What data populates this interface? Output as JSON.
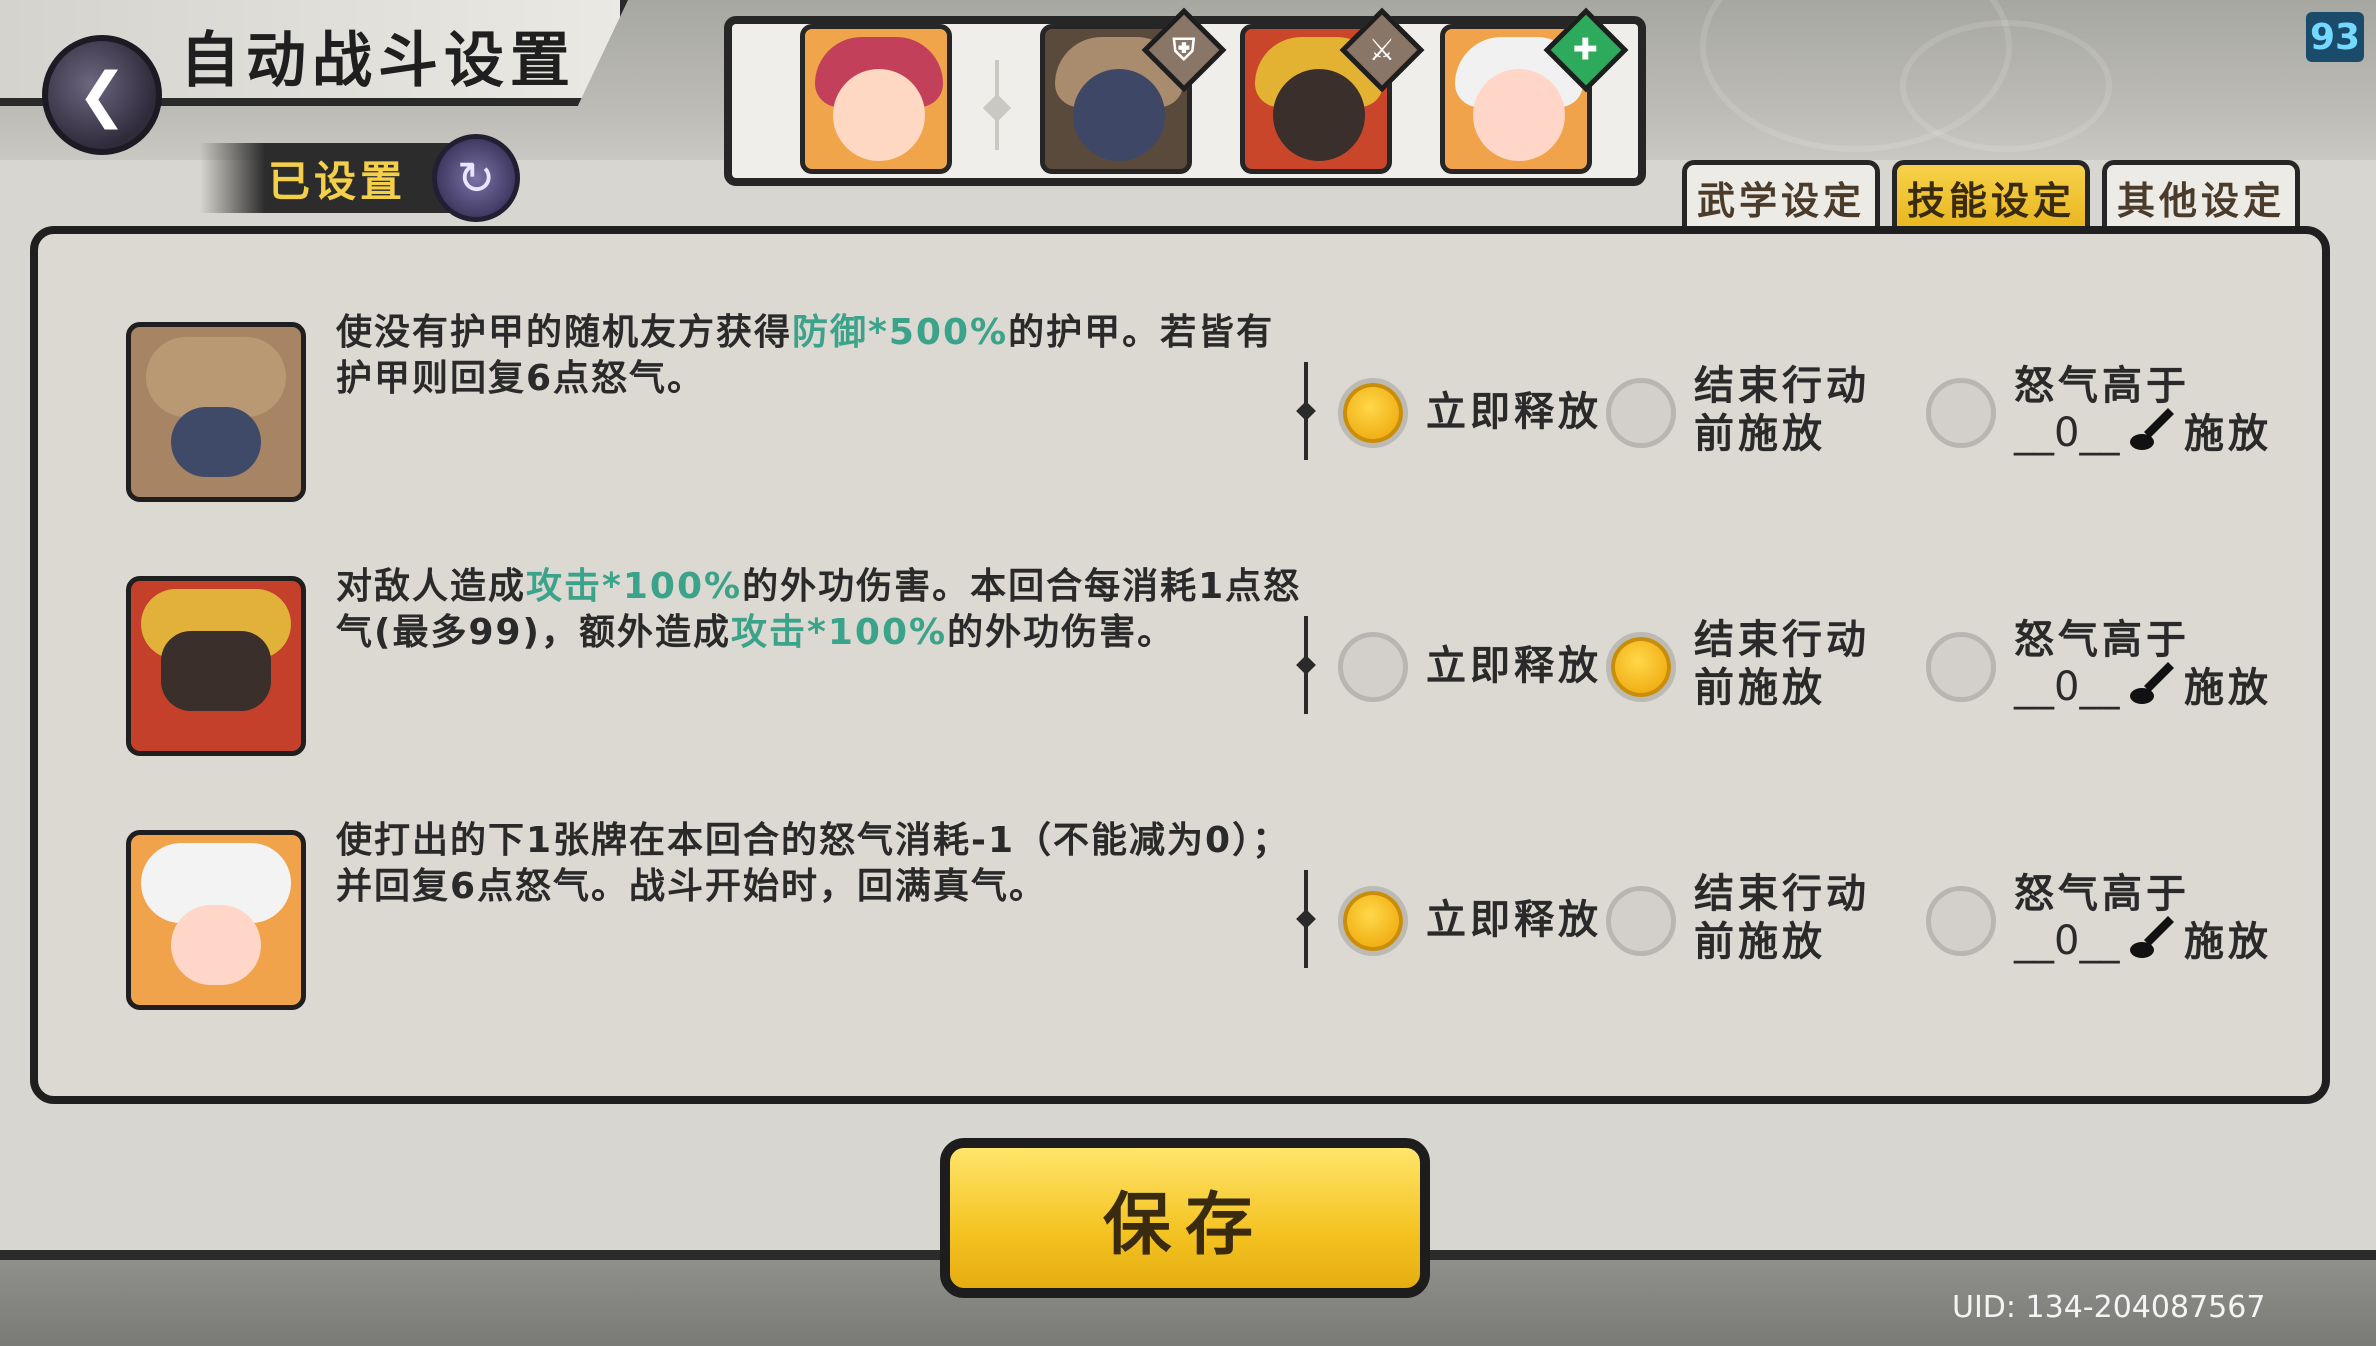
{
  "header": {
    "title": "自动战斗设置",
    "status": "已设置",
    "level": "93"
  },
  "icons": {
    "back": "back-arrow-icon",
    "status": "swirl-icon"
  },
  "team": [
    {
      "name": "portrait-1",
      "badge": ""
    },
    {
      "name": "portrait-2",
      "badge": "shield"
    },
    {
      "name": "portrait-3",
      "badge": "sword"
    },
    {
      "name": "portrait-4",
      "badge": "heal"
    }
  ],
  "tabs": [
    "武学设定",
    "技能设定",
    "其他设定"
  ],
  "active_tab": "技能设定",
  "skills": [
    {
      "desc_parts": [
        "使没有护甲的随机友方获得",
        "防御*500%",
        "的护甲。若皆有护甲则回复6点怒气。"
      ],
      "selected": 0
    },
    {
      "desc_parts": [
        "对敌人造成",
        "攻击*100%",
        "的外功伤害。本回合每消耗1点怒气(最多99)，额外造成",
        "攻击*100%",
        "的外功伤害。"
      ],
      "selected": 1
    },
    {
      "desc_parts": [
        "使打出的下1张牌在本回合的怒气消耗-1（不能减为0）；并回复6点怒气。战斗开始时，回满真气。"
      ],
      "selected": 0
    }
  ],
  "options": {
    "immediate": "立即释放",
    "end_line1": "结束行动",
    "end_line2": "前施放",
    "rage_line1": "怒气高于",
    "rage_value": "__0__",
    "rage_line2": "施放"
  },
  "save_label": "保存",
  "uid": "UID: 134-204087567",
  "colors": {
    "accent": "#f4c322",
    "highlight": "#3ba38a"
  }
}
